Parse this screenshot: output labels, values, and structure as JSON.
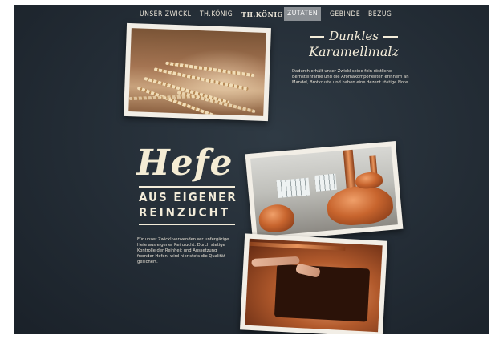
{
  "nav": {
    "items": [
      {
        "label": "UNSER ZWICKL"
      },
      {
        "label": "TH.KÖNIG"
      },
      {
        "label": "TH.KÖNIG"
      },
      {
        "label": "ZUTATEN"
      },
      {
        "label": "GEBINDE"
      },
      {
        "label": "BEZUG"
      }
    ],
    "active_item": "ZUTATEN"
  },
  "section_malt": {
    "title_line1": "Dunkles",
    "title_line2": "Karamellmalz",
    "body": "Dadurch erhält unser Zwickl seine fein-röstliche Bernsteinfarbe und die Aromakomponenten erinnern an Mandel, Brotkruste und haben eine dezent röstige Note."
  },
  "section_yeast": {
    "script_title": "Hefe",
    "subtitle_line1": "AUS EIGENER",
    "subtitle_line2": "REINZUCHT",
    "body": "Für unser Zwickl verwenden wir unfergärige Hefe aus eigener Reinzucht. Durch stetige Kontrolle der Reinheit und Aussetzung fremder Hefen, wird hier stets die Qualität gesichert."
  },
  "colors": {
    "background": "#232c35",
    "text_cream": "#f3ecd9",
    "nav_active_bg": "#8a8f94"
  }
}
